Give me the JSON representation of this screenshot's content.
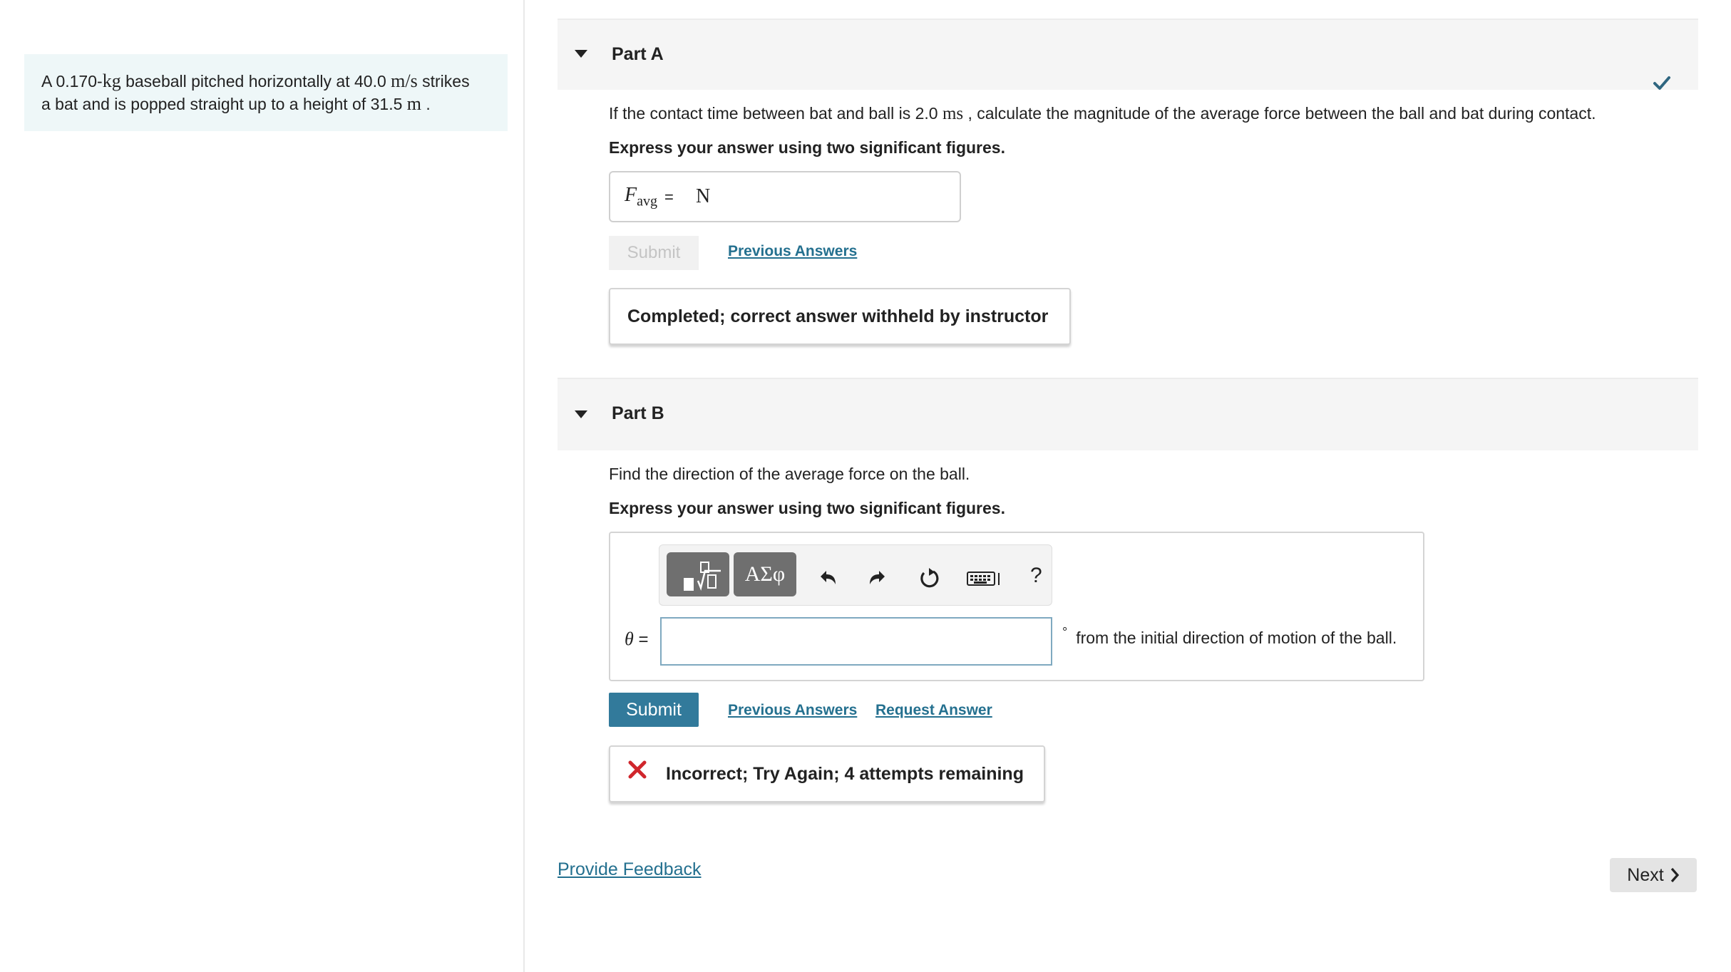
{
  "problem": {
    "before_mass": "A 0.170-",
    "mass_unit": "kg",
    "after_mass": " baseball pitched horizontally at 40.0 ",
    "speed_unit": "m/s",
    "line1_end": " strikes",
    "line2": "a bat and is popped straight up to a height of 31.5 ",
    "height_unit": "m",
    "line2_end": " ."
  },
  "part_a": {
    "title": "Part A",
    "prompt_before": "If the contact time between bat and ball is 2.0 ",
    "time_unit": "ms",
    "prompt_after": " , calculate the magnitude of the average force between the ball and bat during contact.",
    "instruction": "Express your answer using two significant figures.",
    "field_label": "F",
    "field_label_sub": "avg",
    "field_equals": "=",
    "field_unit": "N",
    "submit_label": "Submit",
    "previous_answers": "Previous Answers",
    "feedback": "Completed; correct answer withheld by instructor",
    "status_icon": "check-icon"
  },
  "part_b": {
    "title": "Part B",
    "prompt": "Find the direction of the average force on the ball.",
    "instruction": "Express your answer using two significant figures.",
    "toolbar": {
      "templates_icon": "templates-icon",
      "symbols_label": "ΑΣφ",
      "undo_icon": "undo-icon",
      "redo_icon": "redo-icon",
      "reset_icon": "reset-icon",
      "keyboard_icon": "keyboard-icon",
      "help_label": "?"
    },
    "input_label": "θ",
    "input_equals": " =",
    "input_value": "",
    "degree_symbol": "°",
    "suffix": "from the initial direction of motion of the ball.",
    "submit_label": "Submit",
    "previous_answers": "Previous Answers",
    "request_answer": "Request Answer",
    "feedback": "Incorrect; Try Again; 4 attempts remaining"
  },
  "footer": {
    "provide_feedback": "Provide Feedback",
    "next_label": "Next"
  },
  "colors": {
    "accent": "#327a9b",
    "link": "#24708f",
    "check": "#2f6680",
    "error": "#d0262c",
    "problem_bg": "#eef7f8"
  }
}
